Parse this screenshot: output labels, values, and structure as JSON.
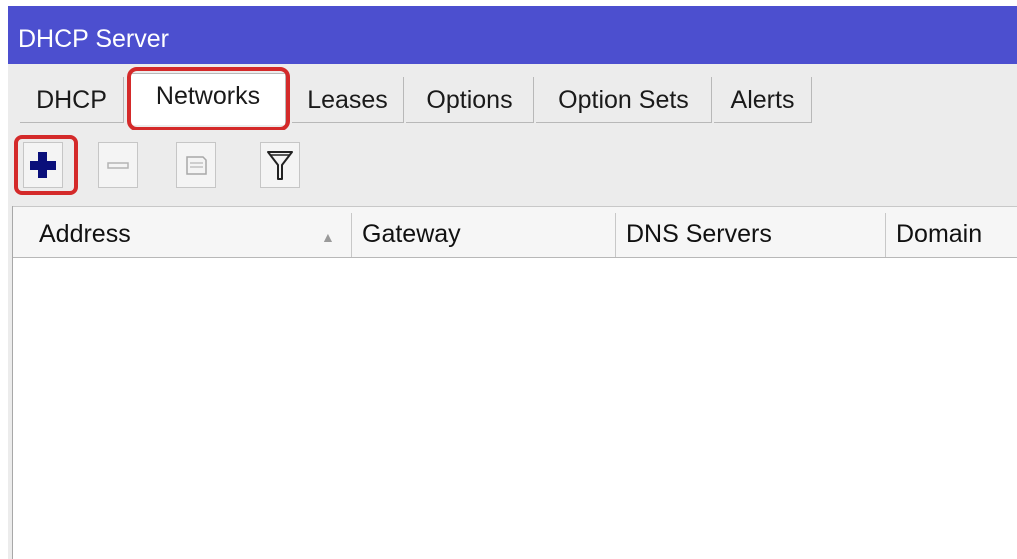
{
  "window": {
    "title": "DHCP Server"
  },
  "tabs": [
    {
      "label": "DHCP",
      "active": false
    },
    {
      "label": "Networks",
      "active": true
    },
    {
      "label": "Leases",
      "active": false
    },
    {
      "label": "Options",
      "active": false
    },
    {
      "label": "Option Sets",
      "active": false
    },
    {
      "label": "Alerts",
      "active": false
    }
  ],
  "toolbar": {
    "buttons": [
      {
        "icon": "plus-icon",
        "enabled": true
      },
      {
        "icon": "minus-icon",
        "enabled": false
      },
      {
        "icon": "comment-icon",
        "enabled": false
      },
      {
        "icon": "filter-icon",
        "enabled": true
      }
    ]
  },
  "table": {
    "columns": [
      {
        "label": "Address",
        "sorted": "ascending"
      },
      {
        "label": "Gateway"
      },
      {
        "label": "DNS Servers"
      },
      {
        "label": "Domain"
      }
    ],
    "rows": []
  },
  "colors": {
    "titlebar": "#4c4fcf",
    "highlight": "#d42a2a",
    "plus_icon": "#0a0f7a"
  }
}
